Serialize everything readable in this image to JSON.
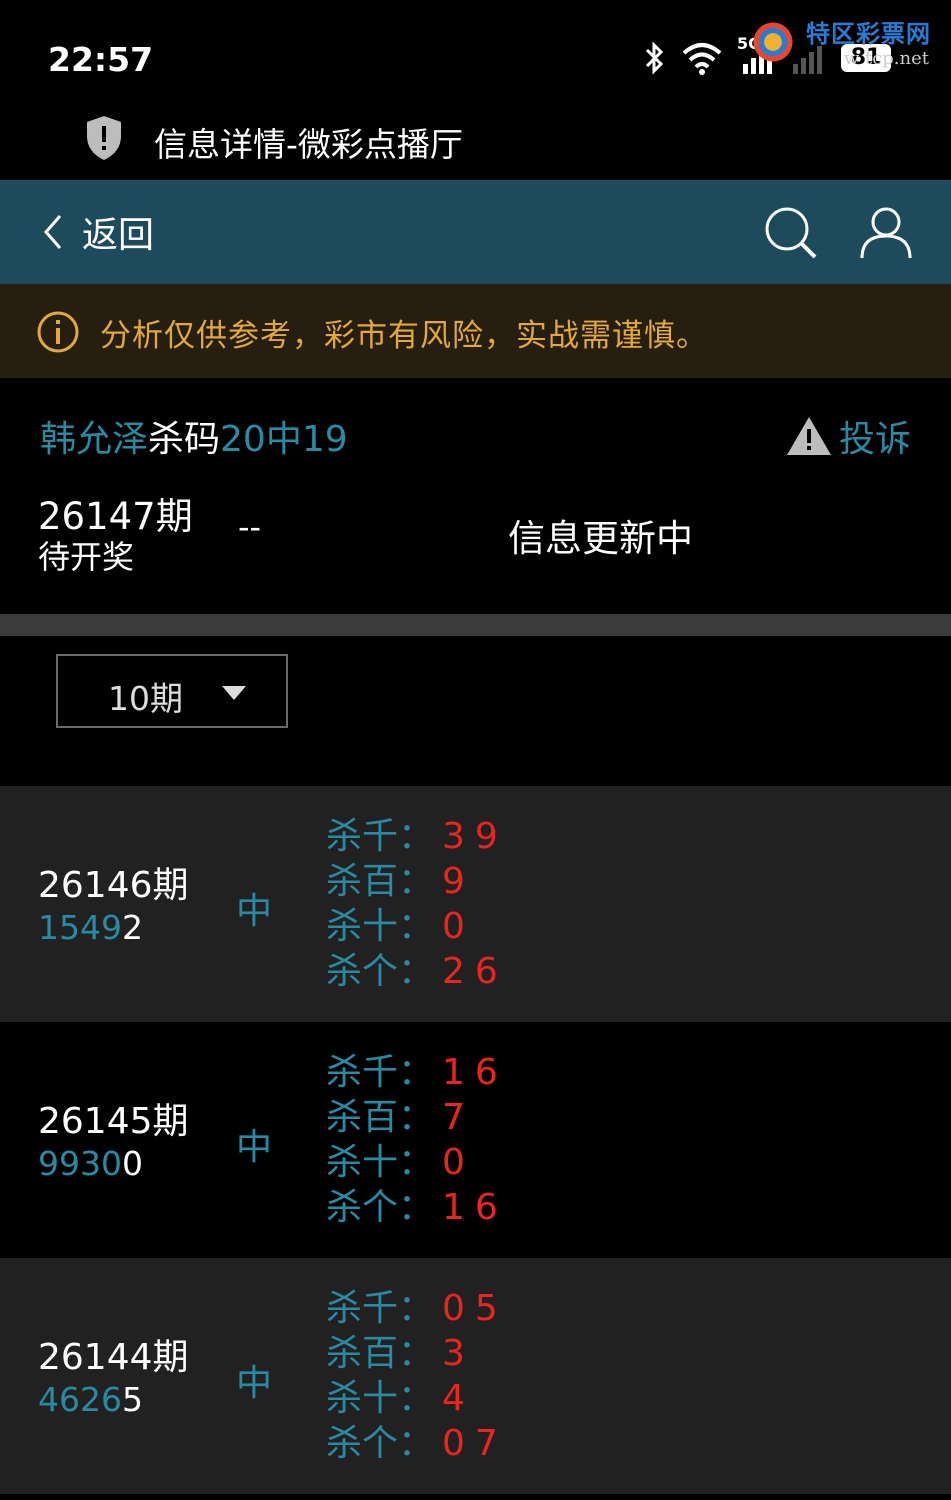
{
  "status_bar": {
    "time": "22:57",
    "network": "5G",
    "battery": "81",
    "watermark_title": "特区彩票网",
    "watermark_url": "w  tcp.net"
  },
  "page": {
    "title": "信息详情-微彩点播厅"
  },
  "nav": {
    "back_label": "返回"
  },
  "notice": {
    "text": "分析仅供参考，彩市有风险，实战需谨慎。"
  },
  "plan": {
    "title_prefix": "韩允泽",
    "title_middle": "杀码",
    "title_suffix": "20中19",
    "complaint_label": "投诉",
    "current_period": "26147期",
    "current_status": "待开奖",
    "current_value": "--",
    "current_info": "信息更新中"
  },
  "filter": {
    "selected": "10期"
  },
  "records": [
    {
      "period": "26146期",
      "number_head": "1549",
      "number_tail": "2",
      "result": "中",
      "kills": [
        {
          "label": "杀千：",
          "value": "39"
        },
        {
          "label": "杀百：",
          "value": "9"
        },
        {
          "label": "杀十：",
          "value": "0"
        },
        {
          "label": "杀个：",
          "value": "26"
        }
      ]
    },
    {
      "period": "26145期",
      "number_head": "9930",
      "number_tail": "0",
      "result": "中",
      "kills": [
        {
          "label": "杀千：",
          "value": "16"
        },
        {
          "label": "杀百：",
          "value": "7"
        },
        {
          "label": "杀十：",
          "value": "0"
        },
        {
          "label": "杀个：",
          "value": "16"
        }
      ]
    },
    {
      "period": "26144期",
      "number_head": "4626",
      "number_tail": "5",
      "result": "中",
      "kills": [
        {
          "label": "杀千：",
          "value": "05"
        },
        {
          "label": "杀百：",
          "value": "3"
        },
        {
          "label": "杀十：",
          "value": "4"
        },
        {
          "label": "杀个：",
          "value": "07"
        }
      ]
    }
  ],
  "colors": {
    "nav_bg": "#1e4b5c",
    "accent_teal": "#2a8aa3",
    "notice_text": "#e2a93a",
    "kill_value": "#e8261f"
  }
}
